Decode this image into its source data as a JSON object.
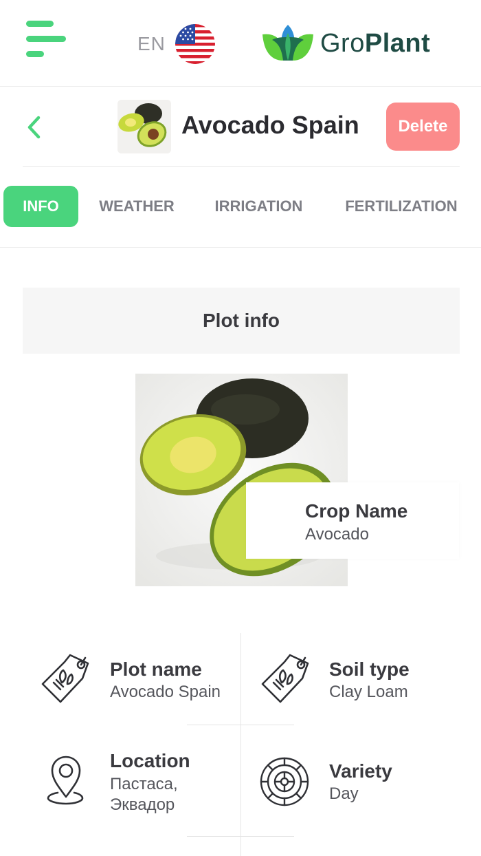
{
  "header": {
    "language_code": "EN",
    "logo": {
      "text_regular": "Gro",
      "text_bold": "Plant"
    }
  },
  "plot": {
    "title": "Avocado Spain",
    "delete_label": "Delete"
  },
  "tabs": [
    {
      "label": "INFO",
      "active": true
    },
    {
      "label": "WEATHER",
      "active": false
    },
    {
      "label": "IRRIGATION",
      "active": false
    },
    {
      "label": "FERTILIZATION",
      "active": false
    }
  ],
  "section": {
    "title": "Plot info"
  },
  "crop": {
    "label": "Crop Name",
    "value": "Avocado"
  },
  "info": {
    "plot_name": {
      "label": "Plot name",
      "value": "Avocado Spain",
      "icon": "tag-icon"
    },
    "soil_type": {
      "label": "Soil type",
      "value": "Clay Loam",
      "icon": "tag-icon"
    },
    "location": {
      "label": "Location",
      "value_line1": "Пастаса,",
      "value_line2": "Эквадор",
      "icon": "location-pin-icon"
    },
    "variety": {
      "label": "Variety",
      "value": "Day",
      "icon": "variety-wheel-icon"
    }
  },
  "colors": {
    "accent": "#4ad47d",
    "delete": "#fb8b8b",
    "logo_text": "#1f4b44"
  }
}
